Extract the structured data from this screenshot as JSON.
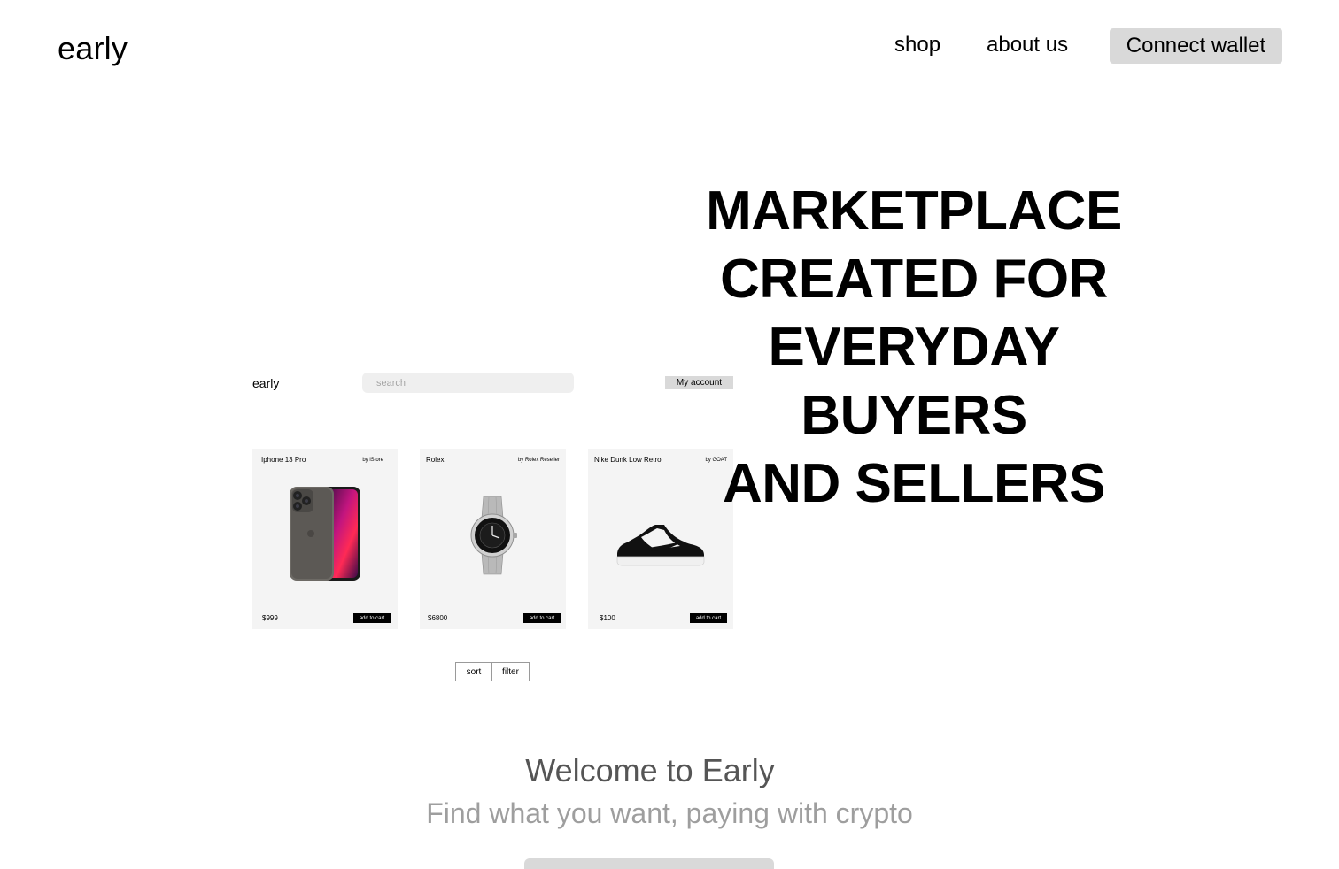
{
  "nav": {
    "logo": "early",
    "links": [
      "shop",
      "about us"
    ],
    "connect_label": "Connect wallet"
  },
  "hero": {
    "headline_lines": [
      "MARKETPLACE",
      "CREATED FOR",
      "EVERYDAY BUYERS",
      "AND SELLERS"
    ]
  },
  "mockup": {
    "logo": "early",
    "search_placeholder": "search",
    "account_label": "My account",
    "products": [
      {
        "name": "Iphone 13 Pro",
        "seller": "by iStore",
        "price": "$999",
        "cart_label": "add to cart",
        "icon": "phone-icon"
      },
      {
        "name": "Rolex",
        "seller": "by Rolex Reseller",
        "price": "$6800",
        "cart_label": "add to cart",
        "icon": "watch-icon"
      },
      {
        "name": "Nike Dunk Low Retro",
        "seller": "by GOAT",
        "price": "$100",
        "cart_label": "add to cart",
        "icon": "sneaker-icon"
      }
    ],
    "controls": [
      "sort",
      "filter"
    ]
  },
  "welcome": {
    "title": "Welcome to Early",
    "subtitle": "Find what you want, paying with crypto"
  },
  "colors": {
    "button_bg": "#d9d9d9",
    "card_bg": "#f4f4f4",
    "title_gray": "#555555",
    "subtitle_gray": "#9e9e9e"
  }
}
